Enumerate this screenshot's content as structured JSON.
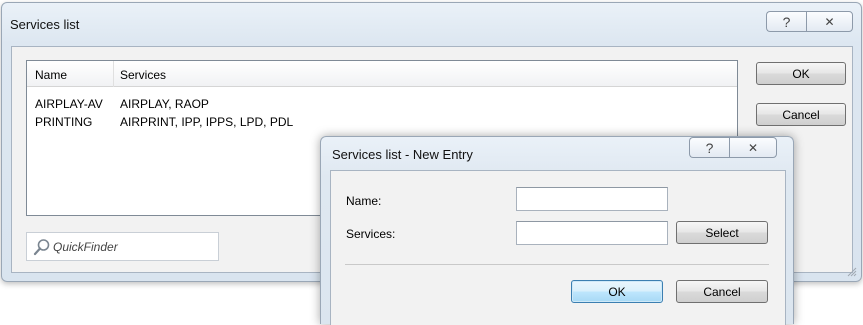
{
  "outer": {
    "title": "Services list",
    "help_label": "?",
    "close_label": "✕",
    "list": {
      "columns": [
        "Name",
        "Services"
      ],
      "rows": [
        {
          "name": "AIRPLAY-AV",
          "services": "AIRPLAY, RAOP"
        },
        {
          "name": "PRINTING",
          "services": "AIRPRINT, IPP, IPPS, LPD, PDL"
        }
      ]
    },
    "ok_label": "OK",
    "cancel_label": "Cancel",
    "quickfinder_placeholder": "QuickFinder"
  },
  "inner": {
    "title": "Services list - New Entry",
    "help_label": "?",
    "close_label": "✕",
    "name_label": "Name:",
    "name_value": "",
    "services_label": "Services:",
    "services_value": "",
    "select_label": "Select",
    "ok_label": "OK",
    "cancel_label": "Cancel"
  }
}
